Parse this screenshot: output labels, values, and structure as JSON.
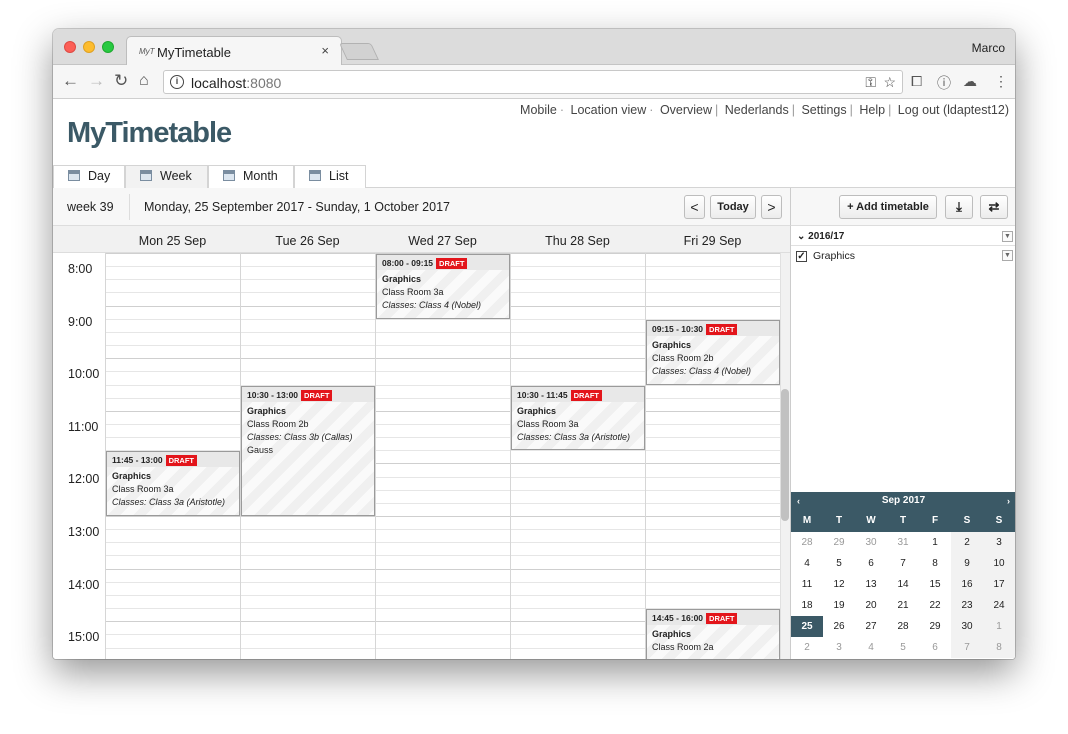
{
  "browser": {
    "tab_title": "MyTimetable",
    "favicon_text": "MyT",
    "close_symbol": "×",
    "profile_name": "Marco",
    "url_host": "localhost",
    "url_port": ":8080"
  },
  "app": {
    "logo": "MyTimetable",
    "top_nav": [
      {
        "label": "Mobile",
        "sep": "·"
      },
      {
        "label": "Location view",
        "sep": "·"
      },
      {
        "label": "Overview",
        "sep": "|"
      },
      {
        "label": "Nederlands",
        "sep": "|"
      },
      {
        "label": "Settings",
        "sep": "|"
      },
      {
        "label": "Help",
        "sep": "|"
      },
      {
        "label": "Log out (ldaptest12)",
        "sep": ""
      }
    ],
    "view_tabs": [
      "Day",
      "Week",
      "Month",
      "List"
    ],
    "active_view": "Week",
    "accent_color": "#3b5966",
    "draft_color": "#e3151b"
  },
  "week_nav": {
    "week_label": "week 39",
    "range": "Monday, 25 September 2017 - Sunday, 1 October 2017",
    "prev": "<",
    "today": "Today",
    "next": ">"
  },
  "side_toolbar": {
    "add_timetable": "+ Add timetable",
    "download_icon": "download-icon",
    "swap_icon": "swap-icon"
  },
  "calendar": {
    "days": [
      "Mon 25 Sep",
      "Tue 26 Sep",
      "Wed 27 Sep",
      "Thu 28 Sep",
      "Fri 29 Sep"
    ],
    "times": [
      "8:00",
      "9:00",
      "10:00",
      "11:00",
      "12:00",
      "13:00",
      "14:00",
      "15:00"
    ],
    "events": [
      {
        "day": 2,
        "start": "08:00",
        "end": "09:15",
        "time": "08:00 - 09:15",
        "badge": "DRAFT",
        "course": "Graphics",
        "room": "Class Room 3a",
        "classes": "Classes: Class 4 (Nobel)",
        "extra": ""
      },
      {
        "day": 4,
        "start": "09:15",
        "end": "10:30",
        "time": "09:15 - 10:30",
        "badge": "DRAFT",
        "course": "Graphics",
        "room": "Class Room 2b",
        "classes": "Classes: Class 4 (Nobel)",
        "extra": ""
      },
      {
        "day": 1,
        "start": "10:30",
        "end": "13:00",
        "time": "10:30 - 13:00",
        "badge": "DRAFT",
        "course": "Graphics",
        "room": "Class Room 2b",
        "classes": "Classes: Class 3b (Callas)",
        "extra": "Gauss"
      },
      {
        "day": 3,
        "start": "10:30",
        "end": "11:45",
        "time": "10:30 - 11:45",
        "badge": "DRAFT",
        "course": "Graphics",
        "room": "Class Room 3a",
        "classes": "Classes: Class 3a (Aristotle)",
        "extra": ""
      },
      {
        "day": 0,
        "start": "11:45",
        "end": "13:00",
        "time": "11:45 - 13:00",
        "badge": "DRAFT",
        "course": "Graphics",
        "room": "Class Room 3a",
        "classes": "Classes: Class 3a (Aristotle)",
        "extra": ""
      },
      {
        "day": 4,
        "start": "14:45",
        "end": "16:00",
        "time": "14:45 - 16:00",
        "badge": "DRAFT",
        "course": "Graphics",
        "room": "Class Room 2a",
        "classes": "",
        "extra": ""
      }
    ]
  },
  "sidebar": {
    "term": "2016/17",
    "timetable": "Graphics",
    "checked": true,
    "checkmark": "✓",
    "mini_calendar": {
      "title": "Sep 2017",
      "prev": "‹",
      "next": "›",
      "dow": [
        "M",
        "T",
        "W",
        "T",
        "F",
        "S",
        "S"
      ],
      "weeks": [
        [
          "28",
          "29",
          "30",
          "31",
          "1",
          "2",
          "3"
        ],
        [
          "4",
          "5",
          "6",
          "7",
          "8",
          "9",
          "10"
        ],
        [
          "11",
          "12",
          "13",
          "14",
          "15",
          "16",
          "17"
        ],
        [
          "18",
          "19",
          "20",
          "21",
          "22",
          "23",
          "24"
        ],
        [
          "25",
          "26",
          "27",
          "28",
          "29",
          "30",
          "1"
        ],
        [
          "2",
          "3",
          "4",
          "5",
          "6",
          "7",
          "8"
        ]
      ],
      "outside_month": [
        [
          0,
          0
        ],
        [
          0,
          1
        ],
        [
          0,
          2
        ],
        [
          0,
          3
        ],
        [
          4,
          6
        ],
        [
          5,
          0
        ],
        [
          5,
          1
        ],
        [
          5,
          2
        ],
        [
          5,
          3
        ],
        [
          5,
          4
        ],
        [
          5,
          5
        ],
        [
          5,
          6
        ]
      ],
      "selected": [
        4,
        0
      ]
    }
  }
}
